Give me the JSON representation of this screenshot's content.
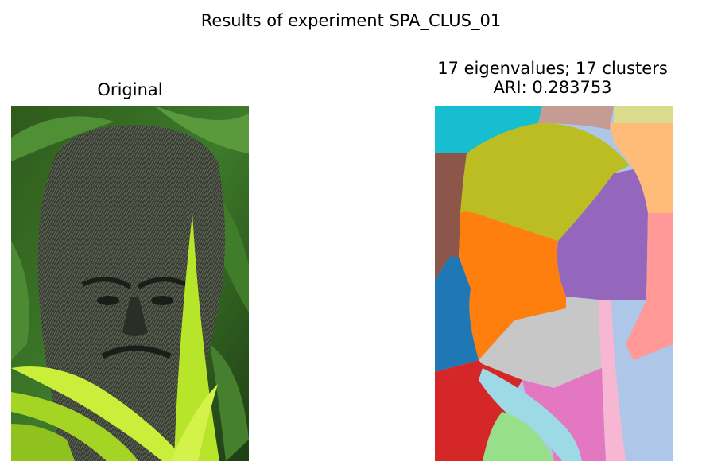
{
  "figure": {
    "title": "Results of experiment SPA_CLUS_01"
  },
  "panels": {
    "original": {
      "title": "Original",
      "image": "photo-stone-face-statue-in-foliage"
    },
    "segmentation": {
      "title_line1": "17 eigenvalues; 17 clusters",
      "title_line2": "ARI: 0.283753",
      "image": "cluster-label-map",
      "cluster_colors": [
        "#17becf",
        "#c49c94",
        "#dbdb8d",
        "#8c564b",
        "#bcbd22",
        "#ffbb78",
        "#9467bd",
        "#ff7f0e",
        "#ff9896",
        "#1f77b4",
        "#c7c7c7",
        "#f7b6d2",
        "#aec7e8",
        "#d62728",
        "#e377c2",
        "#9edae5",
        "#98df8a"
      ]
    }
  }
}
